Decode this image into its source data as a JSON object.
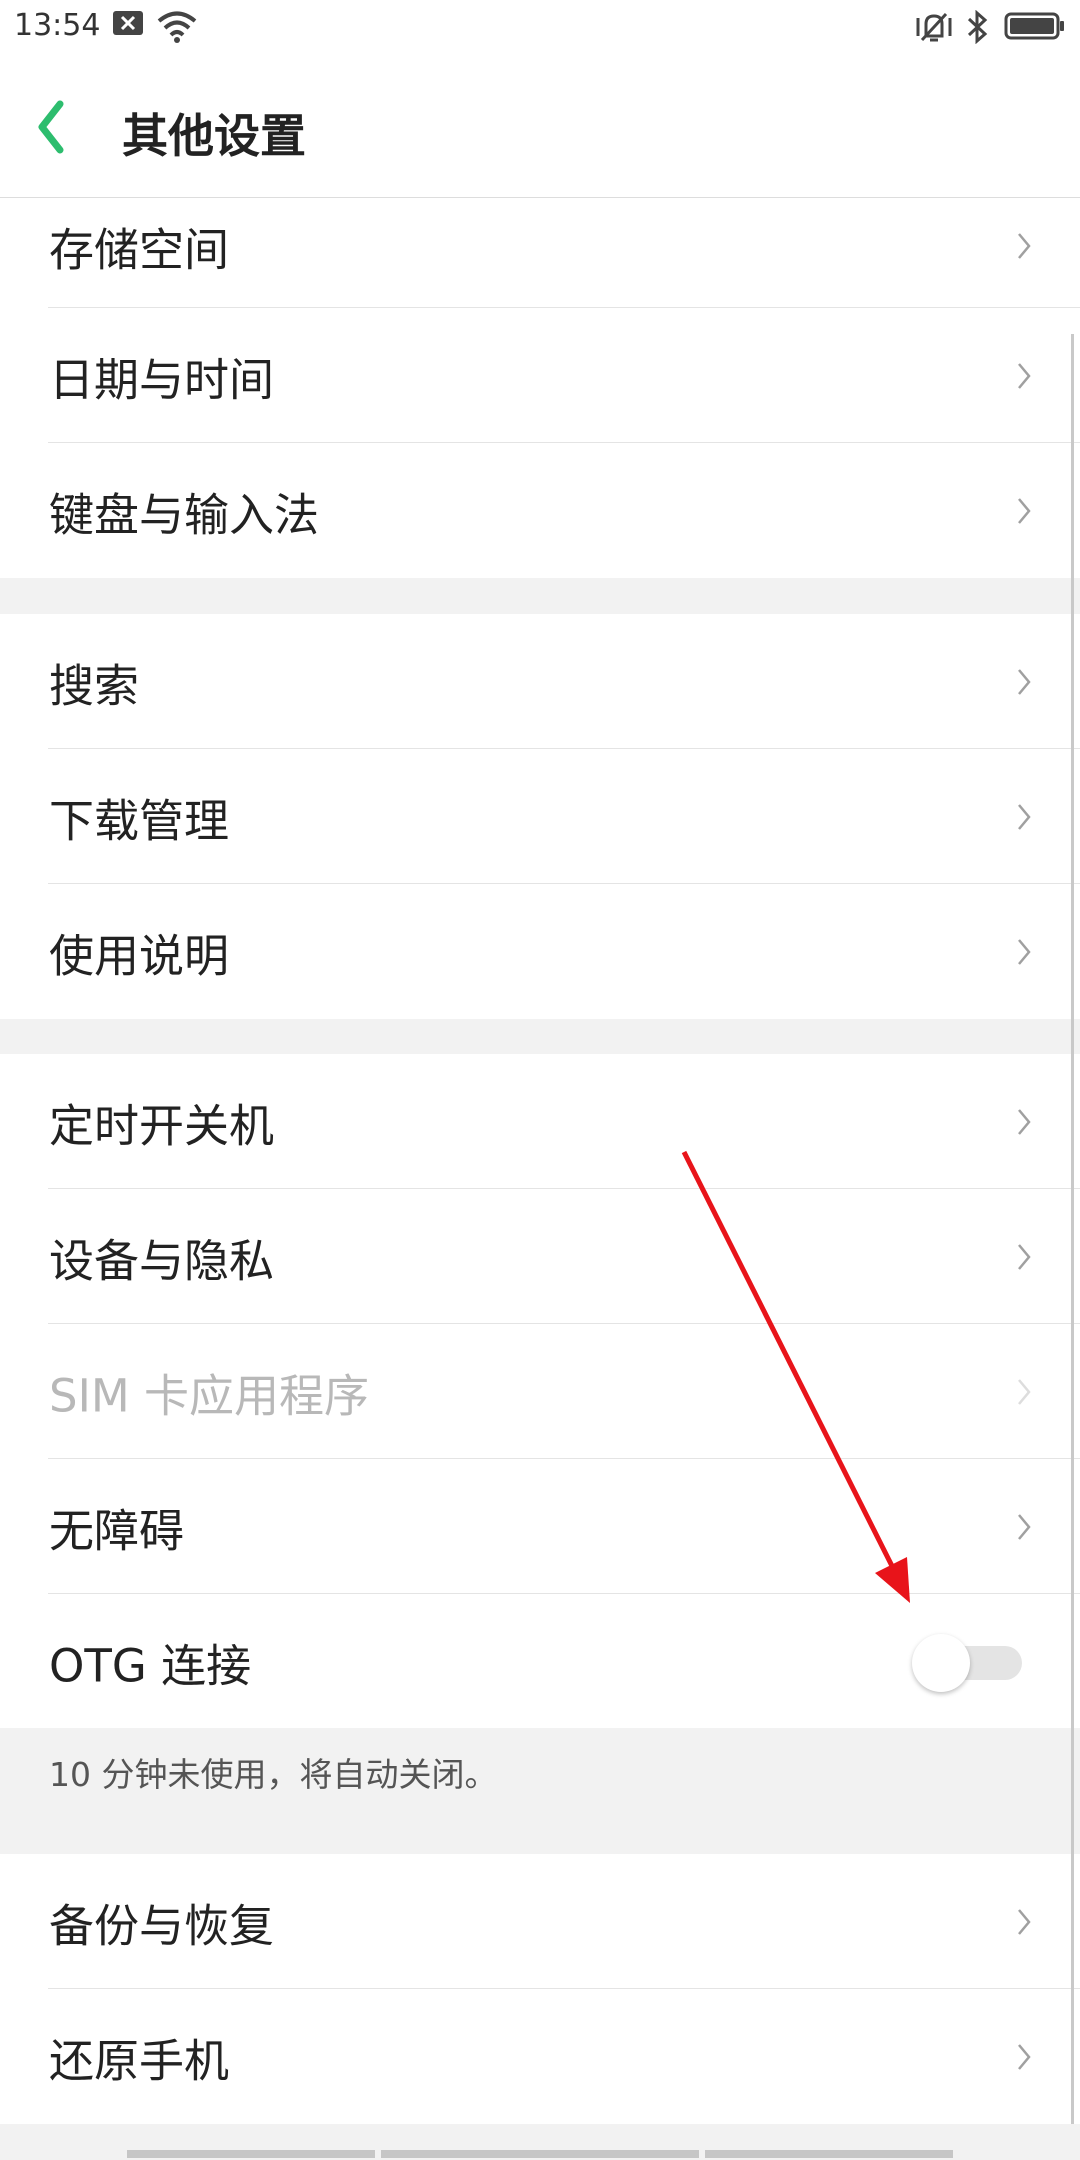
{
  "status_bar": {
    "time": "13:54",
    "icons": [
      "notification-close-icon",
      "wifi-icon",
      "vibrate-icon",
      "bluetooth-icon",
      "battery-icon"
    ]
  },
  "header": {
    "title": "其他设置",
    "back_icon": "chevron-left-icon",
    "accent": "#2dbd6e"
  },
  "sections": [
    {
      "items": [
        {
          "label": "存储空间"
        },
        {
          "label": "日期与时间"
        },
        {
          "label": "键盘与输入法"
        }
      ]
    },
    {
      "items": [
        {
          "label": "搜索"
        },
        {
          "label": "下载管理"
        },
        {
          "label": "使用说明"
        }
      ]
    },
    {
      "items": [
        {
          "label": "定时开关机"
        },
        {
          "label": "设备与隐私"
        },
        {
          "label": "SIM 卡应用程序",
          "disabled": true
        },
        {
          "label": "无障碍"
        },
        {
          "label": "OTG 连接",
          "toggle": false
        }
      ],
      "note": "10 分钟未使用，将自动关闭。"
    },
    {
      "items": [
        {
          "label": "备份与恢复"
        },
        {
          "label": "还原手机"
        }
      ]
    }
  ],
  "colors": {
    "annotation_arrow": "#e8141a",
    "toggle_off_track": "#e4e4e4"
  }
}
